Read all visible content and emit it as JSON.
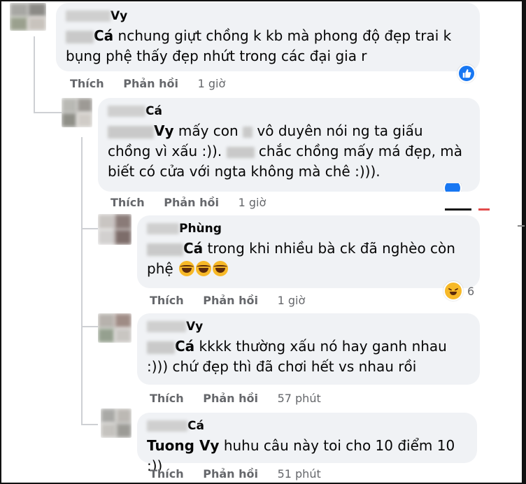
{
  "comments": [
    {
      "author": "Vy",
      "reply_tag": "Cá",
      "text": " nchung giựt chồng k kb mà phong độ đẹp trai k bụng phệ thấy đẹp nhứt trong các đại gia r",
      "like_label": "Thích",
      "reply_label": "Phản hồi",
      "time": "1 giờ",
      "reaction": "like"
    },
    {
      "author": "Cá",
      "reply_tag": "Vy",
      "text_1": " mấy con ",
      "text_2": " vô duyên nói ng ta giấu chồng vì xấu :)). ",
      "text_3": " chắc chồng mấy má đẹp, mà biết có cửa với ngta không mà chê :))).",
      "like_label": "Thích",
      "reply_label": "Phản hồi",
      "time": "1 giờ"
    },
    {
      "author": "Phùng",
      "reply_tag": "Cá",
      "text": " trong khi nhiều bà ck đã nghèo còn phệ ",
      "like_label": "Thích",
      "reply_label": "Phản hồi",
      "time": "1 giờ",
      "reaction": "haha",
      "reaction_count": "6"
    },
    {
      "author": "Vy",
      "reply_tag": "Cá",
      "text": " kkkk thường xấu nó hay ganh nhau :))) chứ đẹp thì đã chơi hết vs nhau rồi",
      "like_label": "Thích",
      "reply_label": "Phản hồi",
      "time": "57 phút"
    },
    {
      "author": "Cá",
      "reply_tag": "Tuong Vy",
      "text": " huhu câu này toi cho 10 điểm 10 :))",
      "like_label": "Thích",
      "reply_label": "Phản hồi",
      "time": "51 phút"
    }
  ],
  "colors": {
    "bubble": "#f0f2f5",
    "meta": "#65676b",
    "like": "#1877f2",
    "haha": "#f7b928"
  }
}
